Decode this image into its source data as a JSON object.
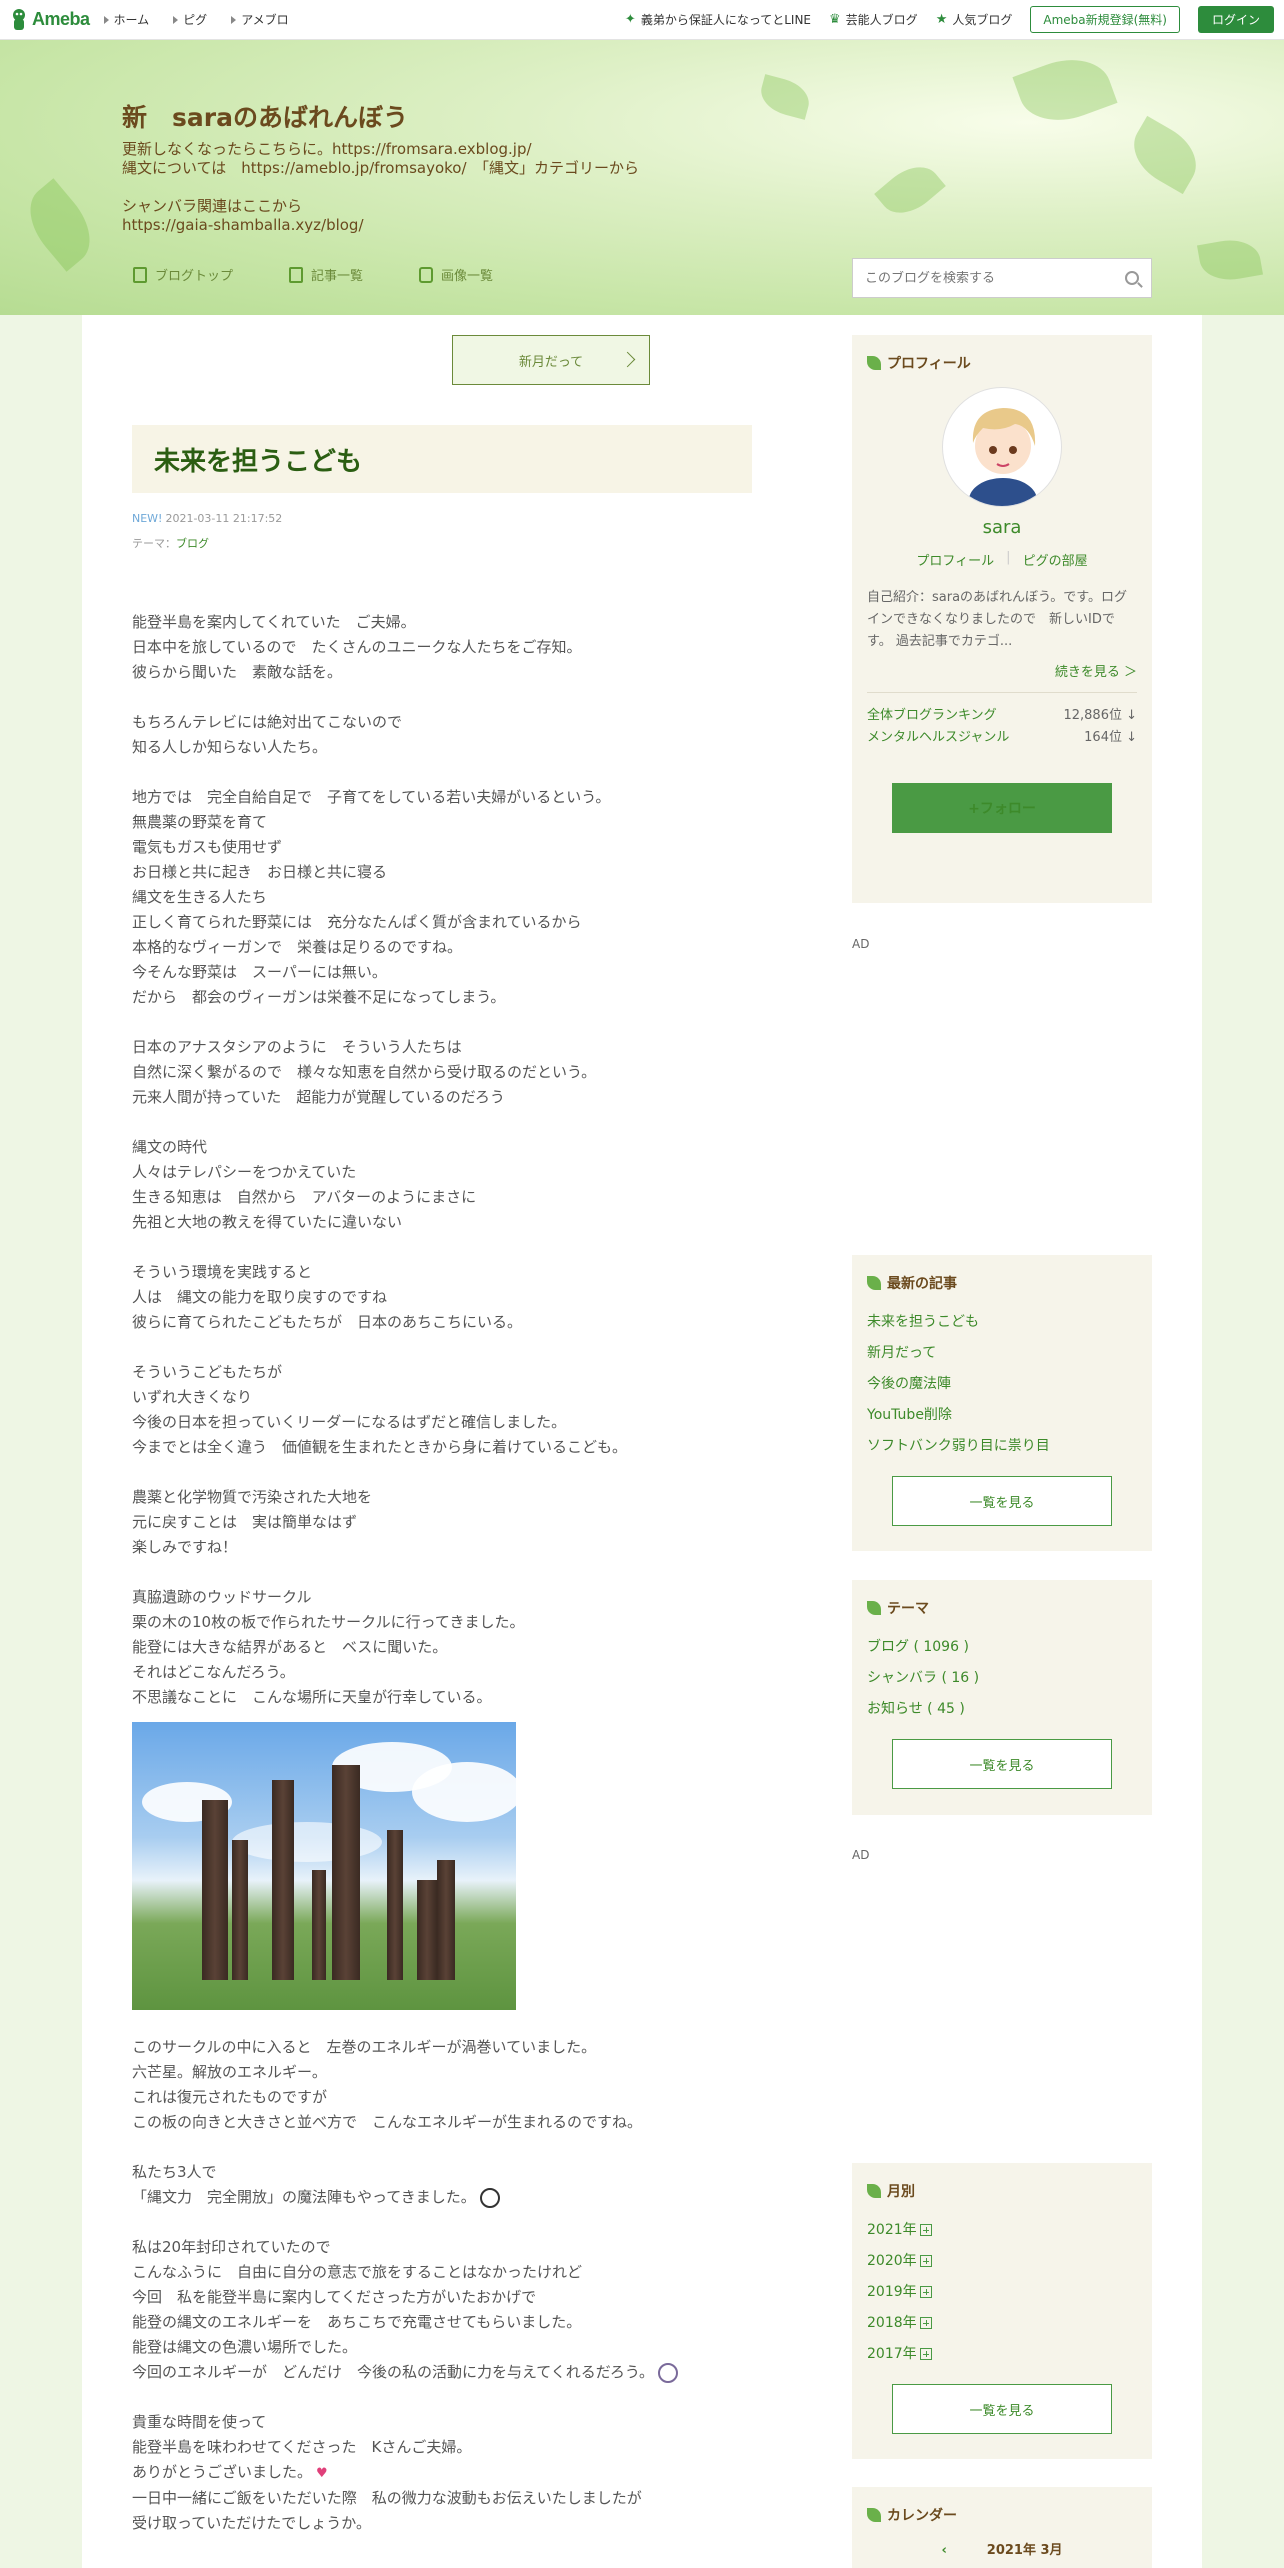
{
  "topbar": {
    "logo": "Ameba",
    "nav": [
      "ホーム",
      "ピグ",
      "アメブロ"
    ],
    "right_links": [
      "義弟から保証人になってとLINE",
      "芸能人ブログ",
      "人気ブログ"
    ],
    "register": "Ameba新規登録(無料)",
    "login": "ログイン"
  },
  "header": {
    "title": "新　saraのあばれんぼう",
    "desc": [
      "更新しなくなったらこちらに。https://fromsara.exblog.jp/",
      "縄文については　https://ameblo.jp/fromsayoko/　「縄文」カテゴリーから",
      "",
      "シャンバラ関連はここから",
      "https://gaia-shamballa.xyz/blog/"
    ],
    "nav": [
      "ブログトップ",
      "記事一覧",
      "画像一覧"
    ],
    "search_placeholder": "このブログを検索する"
  },
  "entry": {
    "next_label": "新月だって",
    "title": "未来を担うこども",
    "new_badge": "NEW!",
    "date": "2021-03-11 21:17:52",
    "theme_label": "テーマ：",
    "theme": "ブログ",
    "paragraphs_before": [
      "能登半島を案内してくれていた　ご夫婦。",
      "日本中を旅しているので　たくさんのユニークな人たちをご存知。",
      "彼らから聞いた　素敵な話を。",
      "",
      "もちろんテレビには絶対出てこないので",
      "知る人しか知らない人たち。",
      "",
      "地方では　完全自給自足で　子育てをしている若い夫婦がいるという。",
      "無農薬の野菜を育て",
      "電気もガスも使用せず",
      "お日様と共に起き　お日様と共に寝る",
      "縄文を生きる人たち",
      "正しく育てられた野菜には　充分なたんぱく質が含まれているから",
      "本格的なヴィーガンで　栄養は足りるのですね。",
      "今そんな野菜は　スーパーには無い。",
      "だから　都会のヴィーガンは栄養不足になってしまう。",
      "",
      "日本のアナスタシアのように　そういう人たちは",
      "自然に深く繋がるので　様々な知恵を自然から受け取るのだという。",
      "元来人間が持っていた　超能力が覚醒しているのだろう",
      "",
      "縄文の時代",
      "人々はテレパシーをつかえていた",
      "生きる知恵は　自然から　アバターのようにまさに",
      "先祖と大地の教えを得ていたに違いない",
      "",
      "そういう環境を実践すると",
      "人は　縄文の能力を取り戻すのですね",
      "彼らに育てられたこどもたちが　日本のあちこちにいる。",
      "",
      "そういうこどもたちが",
      "いずれ大きくなり",
      "今後の日本を担っていくリーダーになるはずだと確信しました。",
      "今までとは全く違う　価値観を生まれたときから身に着けているこども。",
      "",
      "農薬と化学物質で汚染された大地を",
      "元に戻すことは　実は簡単なはず",
      "楽しみですね！",
      "",
      "真脇遺跡のウッドサークル",
      "栗の木の10枚の板で作られたサークルに行ってきました。",
      "能登には大きな結界があると　ベスに聞いた。",
      "それはどこなんだろう。",
      "不思議なことに　こんな場所に天皇が行幸している。"
    ],
    "paragraphs_after": [
      "このサークルの中に入ると　左巻のエネルギーが渦巻いていました。",
      "六芒星。解放のエネルギー。",
      "これは復元されたものですが",
      "この板の向きと大きさと並べ方で　こんなエネルギーが生まれるのですね。",
      "",
      "私たち3人で",
      "「縄文力　完全開放」の魔法陣もやってきました。",
      "",
      "私は20年封印されていたので",
      "こんなふうに　自由に自分の意志で旅をすることはなかったけれど",
      "今回　私を能登半島に案内してくださった方がいたおかげで",
      "能登の縄文のエネルギーを　あちこちで充電させてもらいました。",
      "能登は縄文の色濃い場所でした。",
      "今回のエネルギーが　どんだけ　今後の私の活動に力を与えてくれるだろう。",
      "",
      "貴重な時間を使って",
      "能登半島を味わわせてくださった　Kさんご夫婦。",
      "ありがとうございました。",
      "一日中一緒にご飯をいただいた際　私の微力な波動もお伝えいたしましたが",
      "受け取っていただけたでしょうか。"
    ]
  },
  "sidebar": {
    "profile": {
      "heading": "プロフィール",
      "name": "sara",
      "link1": "プロフィール",
      "link2": "ピグの部屋",
      "desc": "自己紹介：saraのあばれんぼう。です。ログインできなくなりましたので　新しいIDです。 過去記事でカテゴ...",
      "more": "続きを見る ＞",
      "rank1_label": "全体ブログランキング",
      "rank1_value": "12,886位 ↓",
      "rank2_label": "メンタルヘルスジャンル",
      "rank2_value": "164位 ↓",
      "follow": "+フォロー"
    },
    "ad_label": "AD",
    "recent": {
      "heading": "最新の記事",
      "items": [
        "未来を担うこども",
        "新月だって",
        "今後の魔法陣",
        "YouTube削除",
        "ソフトバンク弱り目に祟り目"
      ],
      "button": "一覧を見る"
    },
    "themes": {
      "heading": "テーマ",
      "items": [
        "ブログ ( 1096 )",
        "シャンバラ ( 16 )",
        "お知らせ ( 45 )"
      ],
      "button": "一覧を見る"
    },
    "monthly": {
      "heading": "月別",
      "items": [
        "2021年",
        "2020年",
        "2019年",
        "2018年",
        "2017年"
      ],
      "button": "一覧を見る"
    },
    "calendar": {
      "heading": "カレンダー",
      "month": "2021年 3月"
    }
  }
}
